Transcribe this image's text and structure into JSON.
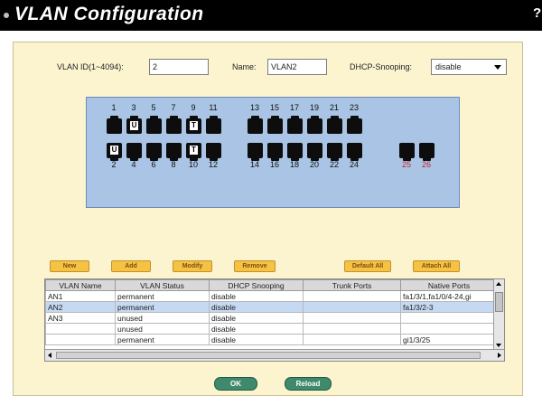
{
  "window": {
    "title": "VLAN Configuration",
    "help_glyph": "?"
  },
  "form": {
    "vlan_id_label": "VLAN ID(1~4094):",
    "vlan_id_value": "2",
    "name_label": "Name:",
    "name_value": "VLAN2",
    "dhcp_label": "DHCP-Snooping:",
    "dhcp_value": "disable"
  },
  "ports": {
    "top_numbers": [
      "1",
      "3",
      "5",
      "7",
      "9",
      "11",
      "13",
      "15",
      "17",
      "19",
      "21",
      "23"
    ],
    "bottom_numbers": [
      "2",
      "4",
      "6",
      "8",
      "10",
      "12",
      "14",
      "16",
      "18",
      "20",
      "22",
      "24",
      "25",
      "26"
    ],
    "top_marks": {
      "3": "U",
      "9": "T"
    },
    "bottom_marks": {
      "2": "U",
      "10": "T"
    },
    "highlight_color": "#c0262c"
  },
  "buttons": {
    "new": "New",
    "add": "Add",
    "modify": "Modify",
    "remove": "Remove",
    "default_all": "Default All",
    "attach_all": "Attach All",
    "ok": "OK",
    "reload": "Reload"
  },
  "table": {
    "headers": [
      "VLAN Name",
      "VLAN Status",
      "DHCP Snooping",
      "Trunk Ports",
      "Native Ports"
    ],
    "rows": [
      [
        "AN1",
        "permanent",
        "disable",
        "",
        "fa1/3/1,fa1/0/4-24,gi"
      ],
      [
        "AN2",
        "permanent",
        "disable",
        "",
        "fa1/3/2-3"
      ],
      [
        "AN3",
        "unused",
        "disable",
        "",
        ""
      ],
      [
        "",
        "unused",
        "disable",
        "",
        ""
      ],
      [
        "",
        "permanent",
        "disable",
        "",
        "gi1/3/25"
      ]
    ],
    "selected_row": 1
  }
}
